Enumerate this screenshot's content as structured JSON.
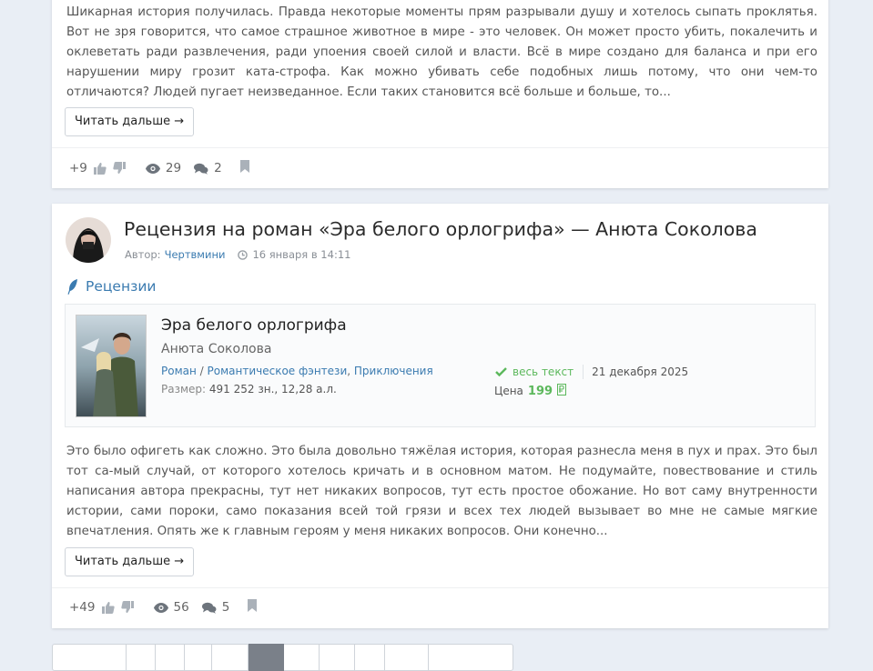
{
  "posts": [
    {
      "excerpt": "Шикарная история получилась. Правда некоторые моменты прям разрывали душу и хотелось сыпать проклятья. Вот не зря говорится, что самое страшное животное в мире - это человек. Он может просто убить, покалечить и оклеветать ради развлечения, ради упоения своей силой и власти. Всё в мире создано для баланса и при его нарушении миру грозит ката-строфа. Как можно убивать себе подобных лишь потому, что они чем-то отличаются? Людей пугает неизведанное. Если таких становится всё больше и больше, то...",
      "read_more": "Читать дальше →",
      "rating": "+9",
      "views": "29",
      "comments": "2"
    },
    {
      "title": "Рецензия на роман «Эра белого орлогрифа» — Анюта Соколова",
      "author_label": "Автор:",
      "author": "Чертвмини",
      "date": "16 января в 14:11",
      "category": "Рецензии",
      "book": {
        "title": "Эра белого орлогрифа",
        "author": "Анюта Соколова",
        "genre1": "Роман",
        "genre_sep1": " / ",
        "genre2": "Романтическое фэнтези",
        "genre_sep2": ", ",
        "genre3": "Приключения",
        "size_label": "Размер:",
        "size_value": "491 252 зн., 12,28 а.л.",
        "status": "весь текст",
        "pub_date": "21 декабря 2025",
        "price_label": "Цена",
        "price": "199",
        "cover_title": "Эра белого орлогрифа"
      },
      "excerpt": "Это было офигеть как сложно. Это была довольно тяжёлая история, которая разнесла меня в пух и прах. Это был тот са-мый случай, от которого хотелось кричать и в основном матом. Не подумайте, повествование и стиль написания автора прекрасны, тут нет никаких вопросов, тут есть простое обожание. Но вот саму внутренности истории, сами пороки, само показания всей той грязи и всех тех людей вызывает во мне не самые мягкие впечатления. Опять же к главным героям у меня никаких вопросов. Они конечно...",
      "read_more": "Читать дальше →",
      "rating": "+49",
      "views": "56",
      "comments": "5"
    }
  ],
  "colors": {
    "link": "#3b7bb0",
    "success": "#5cb85c",
    "background": "#e9eef5",
    "active_page": "#7a8089"
  }
}
